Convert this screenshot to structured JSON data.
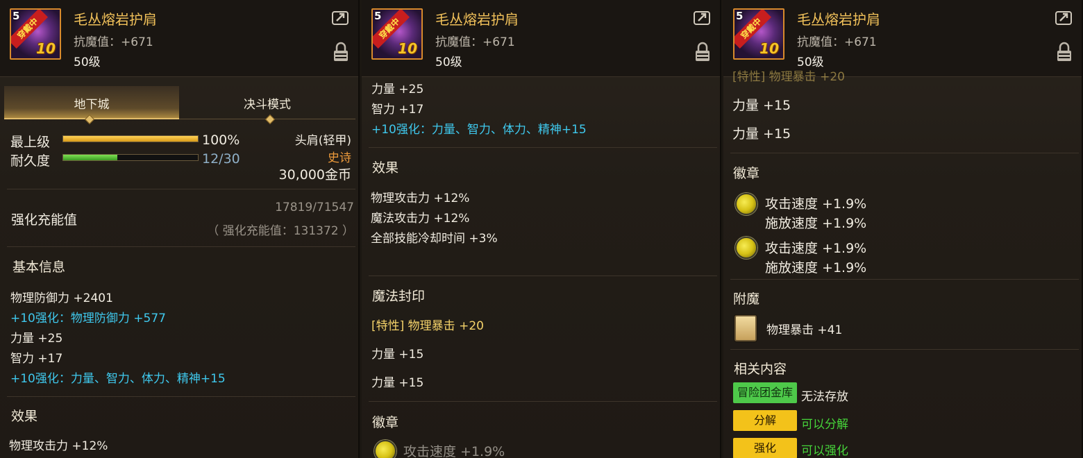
{
  "item": {
    "name": "毛丛熔岩护肩",
    "stat_line": "抗魔值：+671",
    "level_text": "50级",
    "icon_level": "5",
    "icon_equipped": "穿戴中",
    "icon_plus": "10"
  },
  "tabs": [
    "地下城",
    "决斗模式"
  ],
  "status": {
    "grade_label": "最上级",
    "grade_value": "100%",
    "grade_fraction": 1.0,
    "durability_label": "耐久度",
    "durability_value": "12/30",
    "durability_fraction": 0.4,
    "slot": "头肩(轻甲)",
    "rarity": "史诗",
    "price": "30,000金币"
  },
  "charge": {
    "label": "强化充能值",
    "value": "17819/71547",
    "total": "（ 强化充能值：131372 ）"
  },
  "basic_info": {
    "heading": "基本信息",
    "lines": [
      {
        "text": "物理防御力 +2401",
        "color": "white"
      },
      {
        "text": "+10强化：物理防御力 +577",
        "color": "cyan"
      },
      {
        "text": "力量 +25",
        "color": "white"
      },
      {
        "text": "智力 +17",
        "color": "white"
      },
      {
        "text": "+10强化：力量、智力、体力、精神+15",
        "color": "cyan"
      }
    ]
  },
  "effect": {
    "heading": "效果",
    "lines": [
      "物理攻击力 +12%",
      "魔法攻击力 +12%",
      "全部技能冷却时间 +3%"
    ]
  },
  "magic_seal": {
    "heading": "魔法封印",
    "trait_line": "[特性] 物理暴击 +20",
    "lines": [
      "力量 +15",
      "力量 +15"
    ]
  },
  "emblem": {
    "heading": "徽章",
    "slots": [
      {
        "line1": "攻击速度 +1.9%",
        "line2": "施放速度 +1.9%"
      },
      {
        "line1": "攻击速度 +1.9%",
        "line2": "施放速度 +1.9%"
      }
    ]
  },
  "enchant": {
    "heading": "附魔",
    "value": "物理暴击 +41"
  },
  "related": {
    "heading": "相关内容",
    "rows": [
      {
        "tag": "冒险团金库",
        "text": "无法存放"
      },
      {
        "tag": "分解",
        "text": "可以分解"
      },
      {
        "tag": "强化",
        "text": "可以强化"
      }
    ]
  },
  "partial": {
    "p1_bottom": "物理攻击力 +12%",
    "p2_bottom": "攻击速度 +1.9%",
    "p3_top": "[特性] 物理暴击 +20"
  },
  "icons": [
    "share-icon",
    "lock-icon",
    "emblem-icon",
    "enchant-card-icon"
  ],
  "colors": {
    "title": "#f1c15a",
    "cyan": "#3fc9ee",
    "rarity": "#ed9a3b",
    "green_text": "#46d43a",
    "grade_bar": "#f0b52a",
    "durability_bar": "#58c23a"
  }
}
